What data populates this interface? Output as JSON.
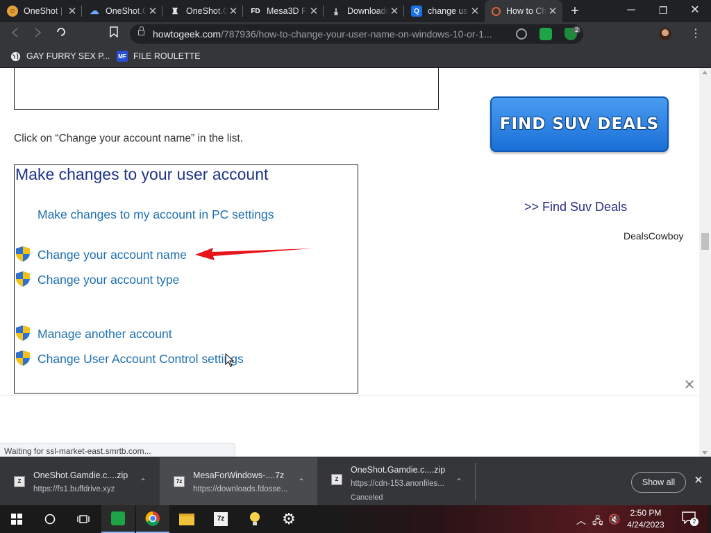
{
  "window": {
    "tabs": [
      {
        "title": "OneShot |",
        "icon": "oneshot-icon"
      },
      {
        "title": "OneShot.G",
        "icon": "cloud-icon"
      },
      {
        "title": "OneShot.G",
        "icon": "figure-icon"
      },
      {
        "title": "Mesa3D F",
        "icon": "fd-icon",
        "icon_text": "FD"
      },
      {
        "title": "Downloads",
        "icon": "download-icon"
      },
      {
        "title": "change us",
        "icon": "q-icon",
        "icon_text": "Q"
      },
      {
        "title": "How to Ch",
        "icon": "htg-icon",
        "active": true
      }
    ],
    "controls": {
      "minimize": "─",
      "restore": "❐",
      "close": "✕"
    }
  },
  "toolbar": {
    "url_host": "howtogeek.com",
    "url_path": "/787936/how-to-change-your-user-name-on-windows-10-or-1...",
    "extension_badge": "2"
  },
  "bookmarks": [
    {
      "label": "GAY FURRY SEX P...",
      "icon": "globe-icon"
    },
    {
      "label": "FILE ROULETTE",
      "icon": "file-roulette-icon",
      "icon_text": "MF"
    }
  ],
  "page": {
    "instruction": "Click on “Change your account name” in the list.",
    "panel_title": "Make changes to your user account",
    "links": [
      {
        "label": "Make changes to my account in PC settings",
        "shield": false
      },
      {
        "label": "Change your account name",
        "shield": true
      },
      {
        "label": "Change your account type",
        "shield": true
      },
      {
        "label": "Manage another account",
        "shield": true
      },
      {
        "label": "Change User Account Control settings",
        "shield": true
      }
    ],
    "ad_button": "FIND SUV DEALS",
    "ad_link": ">> Find Suv Deals",
    "ad_source": "DealsCowboy",
    "arrow_color": "#e8141c"
  },
  "status": {
    "text": "Waiting for ssl-market-east.smrtb.com..."
  },
  "downloads": [
    {
      "name": "OneShot.Gamdie.c....zip",
      "url": "https://fs1.buffdrive.xyz",
      "state": "",
      "icon_text": "Z"
    },
    {
      "name": "MesaForWindows-....7z",
      "url": "https://downloads.fdosse...",
      "state": "",
      "icon_text": "7z"
    },
    {
      "name": "OneShot.Gamdie.c....zip",
      "url": "https://cdn-153.anonfiles...",
      "state": "Canceled",
      "icon_text": "Z"
    }
  ],
  "download_shelf": {
    "show_all": "Show all"
  },
  "taskbar": {
    "time": "2:50 PM",
    "date": "4/24/2023",
    "notification_count": "2"
  }
}
